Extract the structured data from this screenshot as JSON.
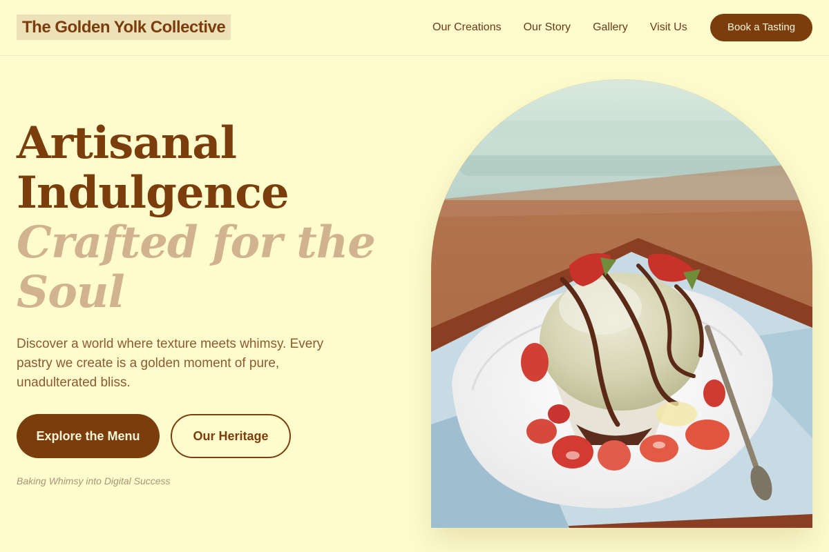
{
  "header": {
    "brand": "The Golden Yolk Collective",
    "nav": [
      "Our Creations",
      "Our Story",
      "Gallery",
      "Visit Us"
    ],
    "cta": "Book a Tasting"
  },
  "hero": {
    "headline_line1": "Artisanal",
    "headline_line2": "Indulgence",
    "headline_accent_line1": "Crafted for the",
    "headline_accent_line2": "Soul",
    "description": "Discover a world where texture meets whimsy. Every pastry we create is a golden moment of pure, unadulterated bliss.",
    "primary_button": "Explore the Menu",
    "secondary_button": "Our Heritage",
    "tagline": "Baking Whimsy into Digital Success"
  },
  "image": {
    "subject": "pistachio ice cream on lava cake with strawberries and chocolate drizzle"
  },
  "colors": {
    "background": "#fefccc",
    "brand_brown": "#7a3d0b",
    "accent_tan": "#d1b48f",
    "logo_highlight": "#ece1b9"
  }
}
